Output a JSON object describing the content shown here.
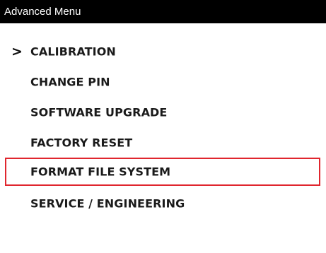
{
  "window": {
    "title": "Advanced Menu"
  },
  "menu": {
    "items": [
      {
        "label": "CALIBRATION",
        "selected": true,
        "cursor_icon": "chevron-right-icon",
        "cursor_glyph": ">"
      },
      {
        "label": "CHANGE PIN",
        "selected": false
      },
      {
        "label": "SOFTWARE UPGRADE",
        "selected": false
      },
      {
        "label": "FACTORY RESET",
        "selected": false
      },
      {
        "label": "FORMAT FILE SYSTEM",
        "selected": false,
        "highlighted": true
      },
      {
        "label": "SERVICE / ENGINEERING",
        "selected": false
      }
    ]
  },
  "colors": {
    "title_bar_bg": "#000000",
    "title_text": "#ffffff",
    "item_text": "#1a1a1a",
    "highlight_border": "#e0262e",
    "background": "#ffffff"
  }
}
